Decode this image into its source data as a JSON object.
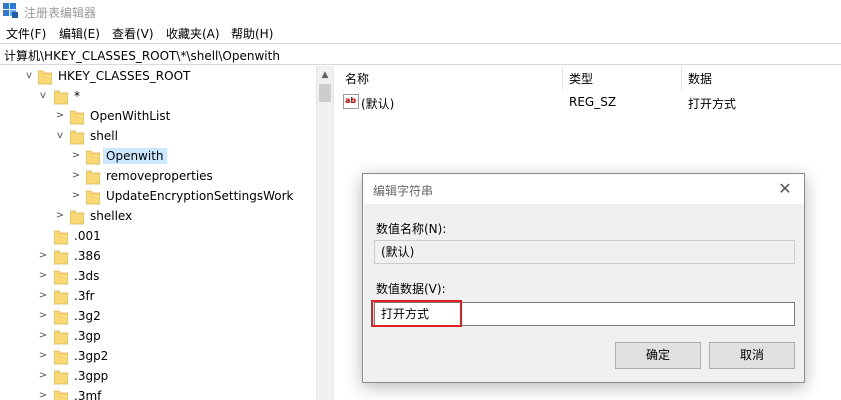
{
  "window": {
    "title": "注册表编辑器"
  },
  "menu": [
    "文件(F)",
    "编辑(E)",
    "查看(V)",
    "收藏夹(A)",
    "帮助(H)"
  ],
  "address": "计算机\\HKEY_CLASSES_ROOT\\*\\shell\\Openwith",
  "tree": [
    {
      "label": "HKEY_CLASSES_ROOT",
      "chevron": "v",
      "level": 0
    },
    {
      "label": "*",
      "chevron": "v",
      "level": 1
    },
    {
      "label": "OpenWithList",
      "chevron": ">",
      "level": 2
    },
    {
      "label": "shell",
      "chevron": "v",
      "level": 2
    },
    {
      "label": "Openwith",
      "chevron": ">",
      "level": 3,
      "selected": true
    },
    {
      "label": "removeproperties",
      "chevron": ">",
      "level": 3
    },
    {
      "label": "UpdateEncryptionSettingsWork",
      "chevron": ">",
      "level": 3
    },
    {
      "label": "shellex",
      "chevron": ">",
      "level": 2
    },
    {
      "label": ".001",
      "chevron": "",
      "level": 1
    },
    {
      "label": ".386",
      "chevron": ">",
      "level": 1
    },
    {
      "label": ".3ds",
      "chevron": ">",
      "level": 1
    },
    {
      "label": ".3fr",
      "chevron": ">",
      "level": 1
    },
    {
      "label": ".3g2",
      "chevron": ">",
      "level": 1
    },
    {
      "label": ".3gp",
      "chevron": ">",
      "level": 1
    },
    {
      "label": ".3gp2",
      "chevron": ">",
      "level": 1
    },
    {
      "label": ".3gpp",
      "chevron": ">",
      "level": 1
    },
    {
      "label": ".3mf",
      "chevron": ">",
      "level": 1
    }
  ],
  "list": {
    "columns": [
      "名称",
      "类型",
      "数据"
    ],
    "rows": [
      {
        "icon": "ab",
        "name": "(默认)",
        "type": "REG_SZ",
        "data": "打开方式"
      }
    ]
  },
  "dialog": {
    "title": "编辑字符串",
    "name_label": "数值名称(N):",
    "name_value": "(默认)",
    "data_label": "数值数据(V):",
    "data_value": "打开方式",
    "ok_label": "确定",
    "cancel_label": "取消"
  },
  "colors": {
    "selection": "#cce8ff",
    "highlight_box": "#e02020",
    "folder": "#f8d775"
  }
}
